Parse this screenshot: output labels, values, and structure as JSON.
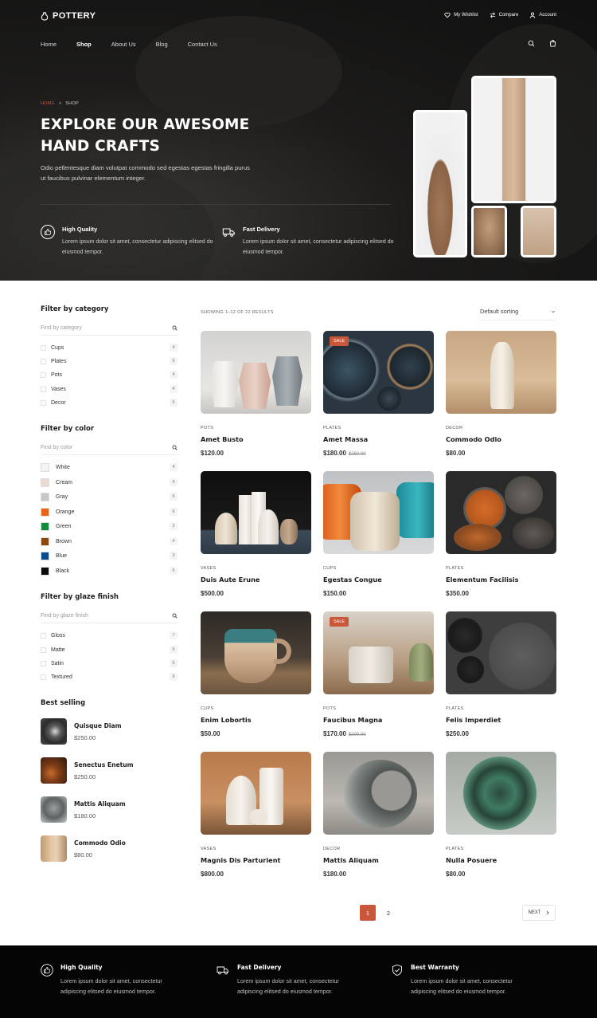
{
  "brand": {
    "name": "POTTERY",
    "accent": "#c9583a"
  },
  "top_links": [
    {
      "icon": "heart-icon",
      "label": "My Wishlist"
    },
    {
      "icon": "compare-icon",
      "label": "Compare"
    },
    {
      "icon": "user-icon",
      "label": "Account"
    }
  ],
  "nav": {
    "items": [
      "Home",
      "Shop",
      "About Us",
      "Blog",
      "Contact Us"
    ],
    "active": "Shop"
  },
  "breadcrumb": {
    "home": "HOME",
    "sep": ">",
    "current": "SHOP"
  },
  "hero": {
    "title_line1": "EXPLORE OUR AWESOME",
    "title_line2": "HAND CRAFTS",
    "description": "Odio pellentesque diam volutpat commodo sed egestas egestas fringilla purus ut faucibus pulvinar elementum integer.",
    "features": [
      {
        "icon": "thumbs-up-icon",
        "title": "High Quality",
        "text": "Lorem ipsum dolor sit amet, consectetur adipiscing elitsed do eiusmod tempor."
      },
      {
        "icon": "truck-icon",
        "title": "Fast Delivery",
        "text": "Lorem ipsum dolor sit amet, consectetur adipiscing elitsed do eiusmod tempor."
      }
    ]
  },
  "filters": {
    "category": {
      "title": "Filter by category",
      "placeholder": "Find by category",
      "items": [
        {
          "label": "Cups",
          "count": "4"
        },
        {
          "label": "Plates",
          "count": "6"
        },
        {
          "label": "Pots",
          "count": "4"
        },
        {
          "label": "Vases",
          "count": "4"
        },
        {
          "label": "Decor",
          "count": "5"
        }
      ]
    },
    "color": {
      "title": "Filter by color",
      "placeholder": "Find by color",
      "items": [
        {
          "label": "White",
          "count": "4",
          "color": "#f4f4f4"
        },
        {
          "label": "Cream",
          "count": "9",
          "color": "#eadbd2"
        },
        {
          "label": "Gray",
          "count": "6",
          "color": "#c7c7c9"
        },
        {
          "label": "Orange",
          "count": "6",
          "color": "#e5651b"
        },
        {
          "label": "Green",
          "count": "2",
          "color": "#138a3c"
        },
        {
          "label": "Brown",
          "count": "4",
          "color": "#8a4a12"
        },
        {
          "label": "Blue",
          "count": "3",
          "color": "#0c4a8c"
        },
        {
          "label": "Black",
          "count": "6",
          "color": "#0a0a0a"
        }
      ]
    },
    "glaze": {
      "title": "Filter by glaze finish",
      "placeholder": "Find by glaze finish",
      "items": [
        {
          "label": "Gloss",
          "count": "7"
        },
        {
          "label": "Matte",
          "count": "5"
        },
        {
          "label": "Satin",
          "count": "5"
        },
        {
          "label": "Textured",
          "count": "9"
        }
      ]
    }
  },
  "best_selling": {
    "title": "Best selling",
    "items": [
      {
        "name": "Quisque Diam",
        "price": "$250.00"
      },
      {
        "name": "Senectus Enetum",
        "price": "$250.00"
      },
      {
        "name": "Mattis Aliquam",
        "price": "$180.00"
      },
      {
        "name": "Commodo Odio",
        "price": "$80.00"
      }
    ]
  },
  "results": {
    "label": "SHOWING 1–12 OF 22 RESULTS",
    "sort": "Default sorting"
  },
  "products": [
    {
      "category": "POTS",
      "name": "Amet Busto",
      "price": "$120.00",
      "old": "",
      "sale": ""
    },
    {
      "category": "PLATES",
      "name": "Amet Massa",
      "price": "$180.00",
      "old": "$250.00",
      "sale": "SALE"
    },
    {
      "category": "DECOR",
      "name": "Commodo Odio",
      "price": "$80.00",
      "old": "",
      "sale": ""
    },
    {
      "category": "VASES",
      "name": "Duis Aute Erune",
      "price": "$500.00",
      "old": "",
      "sale": ""
    },
    {
      "category": "CUPS",
      "name": "Egestas Congue",
      "price": "$150.00",
      "old": "",
      "sale": ""
    },
    {
      "category": "PLATES",
      "name": "Elementum Facilisis",
      "price": "$350.00",
      "old": "",
      "sale": ""
    },
    {
      "category": "CUPS",
      "name": "Enim Lobortis",
      "price": "$50.00",
      "old": "",
      "sale": ""
    },
    {
      "category": "POTS",
      "name": "Faucibus Magna",
      "price": "$170.00",
      "old": "$200.00",
      "sale": "SALE"
    },
    {
      "category": "PLATES",
      "name": "Felis Imperdiet",
      "price": "$250.00",
      "old": "",
      "sale": ""
    },
    {
      "category": "VASES",
      "name": "Magnis Dis Parturient",
      "price": "$800.00",
      "old": "",
      "sale": ""
    },
    {
      "category": "DECOR",
      "name": "Mattis Aliquam",
      "price": "$180.00",
      "old": "",
      "sale": ""
    },
    {
      "category": "PLATES",
      "name": "Nulla Posuere",
      "price": "$80.00",
      "old": "",
      "sale": ""
    }
  ],
  "pagination": {
    "pages": [
      "1",
      "2"
    ],
    "current": "1",
    "next": "NEXT"
  },
  "footer": {
    "features": [
      {
        "icon": "thumbs-up-icon",
        "title": "High Quality",
        "text": "Lorem ipsum dolor sit amet, consectetur adipiscing elitsed do eiusmod tempor."
      },
      {
        "icon": "truck-icon",
        "title": "Fast Delivery",
        "text": "Lorem ipsum dolor sit amet, consectetur adipiscing elitsed do eiusmod tempor."
      },
      {
        "icon": "shield-check-icon",
        "title": "Best Warranty",
        "text": "Lorem ipsum dolor sit amet, consectetur adipiscing elitsed do eiusmod tempor."
      }
    ]
  }
}
